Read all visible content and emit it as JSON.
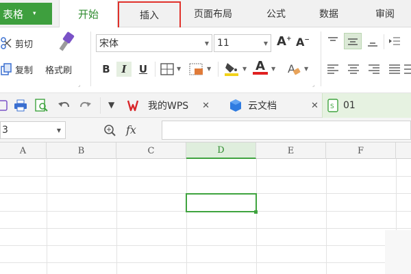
{
  "app_menu": {
    "label": "表格",
    "arrow": "▾"
  },
  "tabs": {
    "home": "开始",
    "insert": "插入",
    "layout": "页面布局",
    "formula": "公式",
    "data": "数据",
    "review": "审阅"
  },
  "ribbon": {
    "cut": "剪切",
    "copy": "复制",
    "format_painter": "格式刷",
    "font_name": "宋体",
    "font_size": "11",
    "bold": "B",
    "italic": "I",
    "underline": "U",
    "font_grow": "A",
    "font_shrink": "A",
    "font_color_glyph": "A"
  },
  "quickbar": {
    "wps_tab": "我的WPS",
    "cloud_tab": "云文档",
    "file_tab": "01",
    "close_glyph": "✕"
  },
  "formulabar": {
    "namebox": "3",
    "fx": "fx"
  },
  "columns": [
    "A",
    "B",
    "C",
    "D",
    "E",
    "F"
  ],
  "colors": {
    "accent_green": "#3e9f3e",
    "insert_highlight": "#e0302a",
    "font_color_red": "#e02020",
    "fill_yellow": "#f2d21a"
  }
}
